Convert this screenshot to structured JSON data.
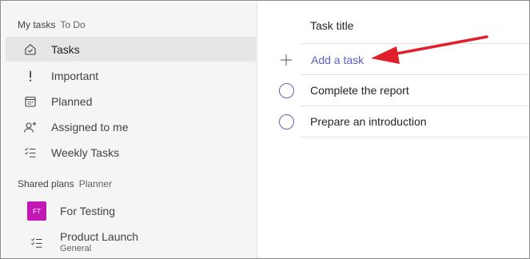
{
  "sidebar": {
    "my_tasks_header": "My tasks",
    "my_tasks_sub": "To Do",
    "items": [
      {
        "label": "Tasks",
        "icon": "home-icon"
      },
      {
        "label": "Important",
        "icon": "exclamation-icon"
      },
      {
        "label": "Planned",
        "icon": "calendar-icon"
      },
      {
        "label": "Assigned to me",
        "icon": "person-add-icon"
      },
      {
        "label": "Weekly Tasks",
        "icon": "checklist-icon"
      }
    ],
    "shared_header": "Shared plans",
    "shared_sub": "Planner",
    "plans": [
      {
        "label": "For Testing",
        "badge": "FT",
        "badge_color": "#c219b5"
      },
      {
        "label": "Product Launch",
        "sub": "General",
        "icon": "checklist-icon"
      }
    ]
  },
  "main": {
    "column_header": "Task title",
    "add_task_label": "Add a task",
    "tasks": [
      {
        "label": "Complete the report"
      },
      {
        "label": "Prepare an introduction"
      }
    ]
  },
  "colors": {
    "accent": "#5b5fc7",
    "circle": "#6264a7",
    "annotation_arrow": "#e0202b"
  }
}
